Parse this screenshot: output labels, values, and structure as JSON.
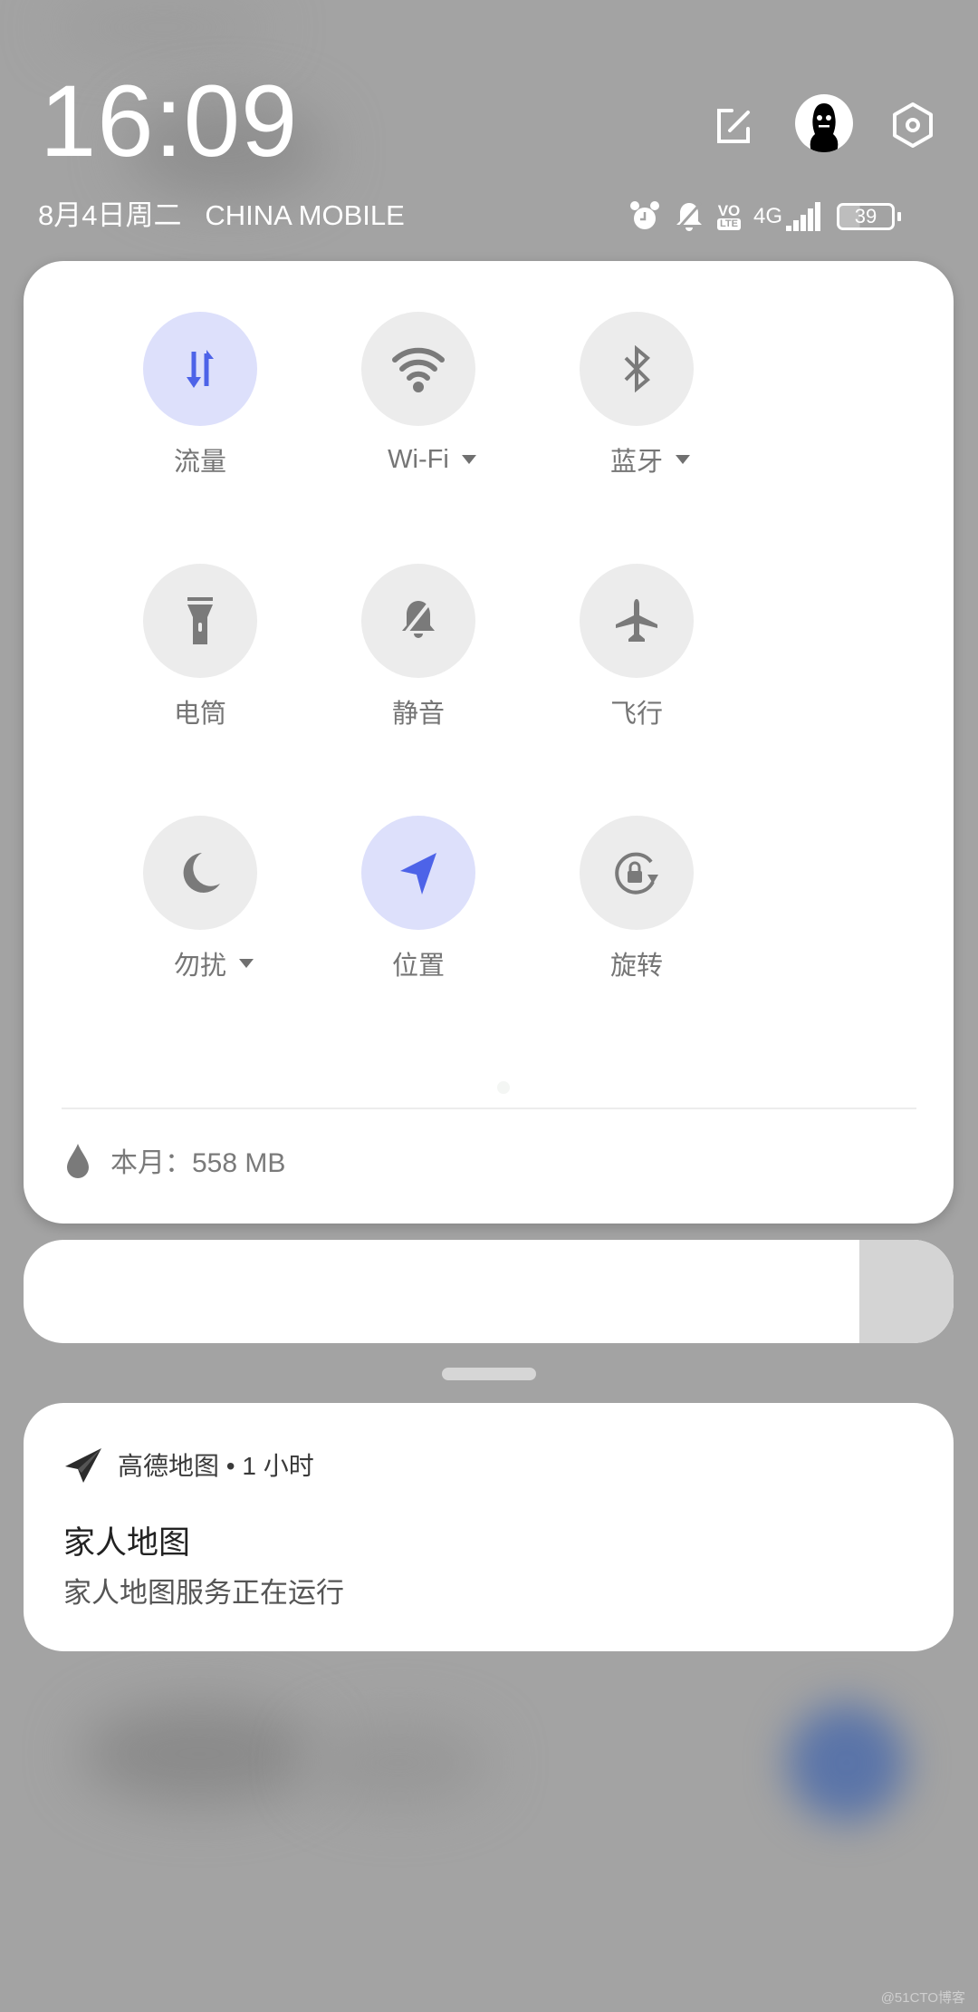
{
  "header": {
    "time": "16:09",
    "date": "8月4日周二",
    "carrier": "CHINA MOBILE",
    "actions": [
      {
        "name": "edit",
        "icon": "edit-icon"
      },
      {
        "name": "account",
        "icon": "avatar-icon"
      },
      {
        "name": "settings",
        "icon": "gear-icon"
      }
    ],
    "status": {
      "icons": [
        "alarm-icon",
        "mute-icon",
        "volte-icon"
      ],
      "volte_top": "VO",
      "volte_bottom": "LTE",
      "network": "4G",
      "battery": "39"
    }
  },
  "quick_settings": {
    "tiles": [
      {
        "label": "流量",
        "icon": "data-transfer-icon",
        "active": true,
        "has_dropdown": false
      },
      {
        "label": "Wi-Fi",
        "icon": "wifi-icon",
        "active": false,
        "has_dropdown": true
      },
      {
        "label": "蓝牙",
        "icon": "bluetooth-icon",
        "active": false,
        "has_dropdown": true
      },
      {
        "label": "电筒",
        "icon": "flashlight-icon",
        "active": false,
        "has_dropdown": false
      },
      {
        "label": "静音",
        "icon": "mute-icon",
        "active": false,
        "has_dropdown": false
      },
      {
        "label": "飞行",
        "icon": "airplane-icon",
        "active": false,
        "has_dropdown": false
      },
      {
        "label": "勿扰",
        "icon": "moon-icon",
        "active": false,
        "has_dropdown": true
      },
      {
        "label": "位置",
        "icon": "location-icon",
        "active": true,
        "has_dropdown": false
      },
      {
        "label": "旋转",
        "icon": "rotation-lock-icon",
        "active": false,
        "has_dropdown": false
      }
    ],
    "usage_label": "本月：558 MB"
  },
  "notification": {
    "app_name": "高德地图",
    "separator": "•",
    "time_ago": "1 小时",
    "app_line": "高德地图 • 1 小时",
    "title": "家人地图",
    "body": "家人地图服务正在运行"
  },
  "colors": {
    "accent": "#4d63e8",
    "accent_bg": "#dde0fb",
    "tile_bg": "#ececec",
    "icon_gray": "#7a7a7a"
  },
  "watermark": "@51CTO博客"
}
